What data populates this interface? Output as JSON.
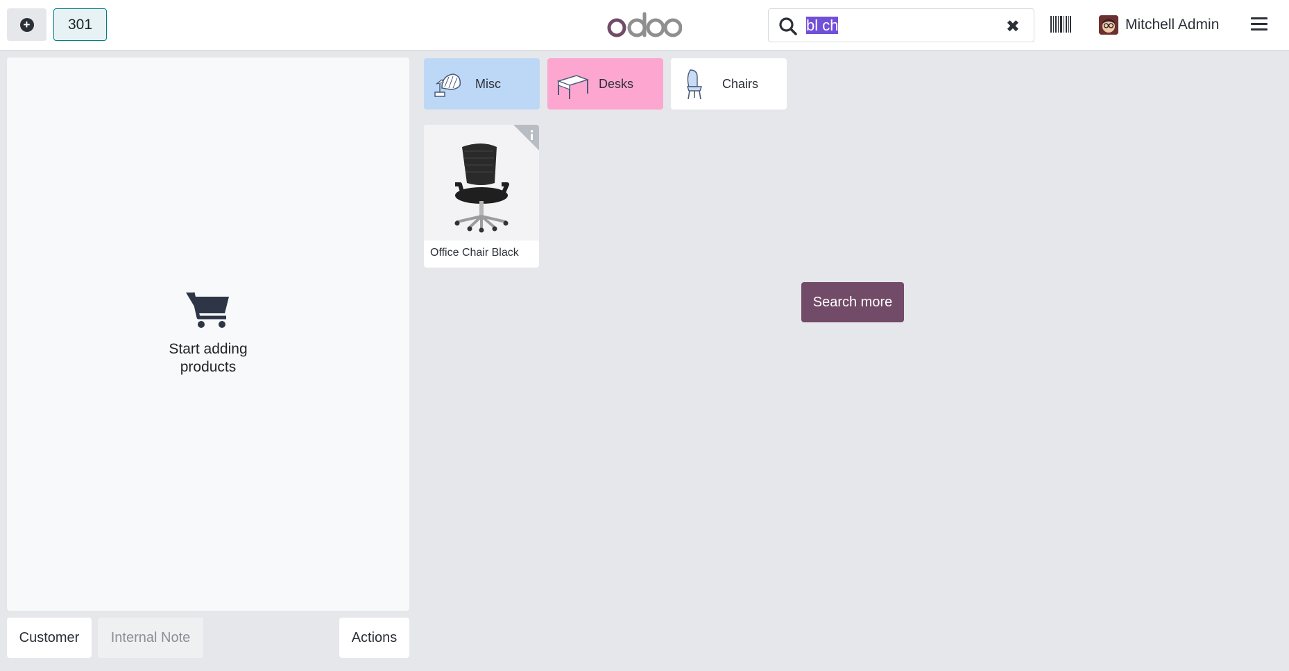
{
  "topbar": {
    "new_order_icon": "plus-circle-icon",
    "order_tab": "301",
    "logo_text": "odoo",
    "search": {
      "value": "bl ch",
      "clear_icon": "close-icon",
      "icon": "search-icon"
    },
    "barcode_icon": "barcode-icon",
    "user_name": "Mitchell Admin",
    "menu_icon": "hamburger-menu-icon"
  },
  "order_panel": {
    "empty_icon": "shopping-cart-icon",
    "empty_line1": "Start adding",
    "empty_line2": "products"
  },
  "bottom_actions": {
    "customer": "Customer",
    "internal_note": "Internal Note",
    "actions": "Actions"
  },
  "categories": [
    {
      "label": "Misc",
      "color": "#bdd8f6",
      "icon": "misc-category-icon"
    },
    {
      "label": "Desks",
      "color": "#fca6d0",
      "icon": "desk-icon"
    },
    {
      "label": "Chairs",
      "color": "#ffffff",
      "icon": "chair-icon"
    }
  ],
  "products": [
    {
      "name": "Office Chair Black",
      "info_icon": "info-icon"
    }
  ],
  "search_more": "Search more",
  "colors": {
    "brand": "#714b67",
    "background": "#e6e7eb",
    "selected_tab_border": "#017e84"
  }
}
